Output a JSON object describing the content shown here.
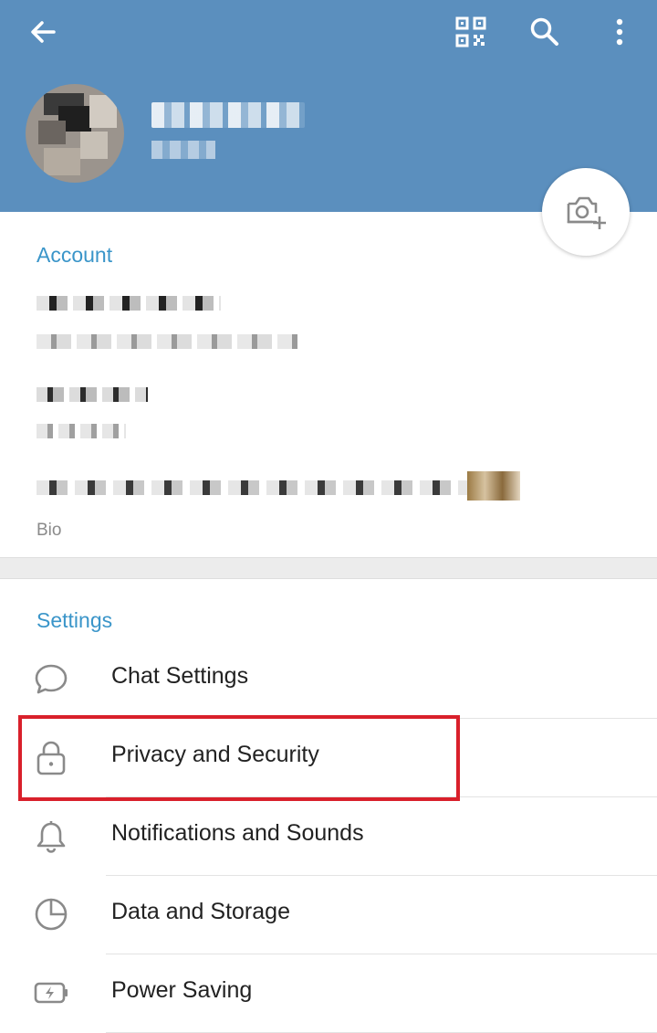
{
  "header": {
    "bg_color": "#5b8fbe",
    "back_icon": "arrow-left-icon",
    "qr_icon": "qr-code-icon",
    "search_icon": "search-icon",
    "more_icon": "more-vertical-icon",
    "camera_icon": "camera-add-icon"
  },
  "account": {
    "title": "Account",
    "bio_label": "Bio"
  },
  "settings": {
    "title": "Settings",
    "items": [
      {
        "label": "Chat Settings",
        "icon": "chat-bubble-icon"
      },
      {
        "label": "Privacy and Security",
        "icon": "lock-icon"
      },
      {
        "label": "Notifications and Sounds",
        "icon": "bell-icon"
      },
      {
        "label": "Data and Storage",
        "icon": "pie-chart-icon"
      },
      {
        "label": "Power Saving",
        "icon": "battery-charging-icon"
      }
    ]
  },
  "colors": {
    "accent": "#3a95c9",
    "highlight": "#d9202b"
  }
}
